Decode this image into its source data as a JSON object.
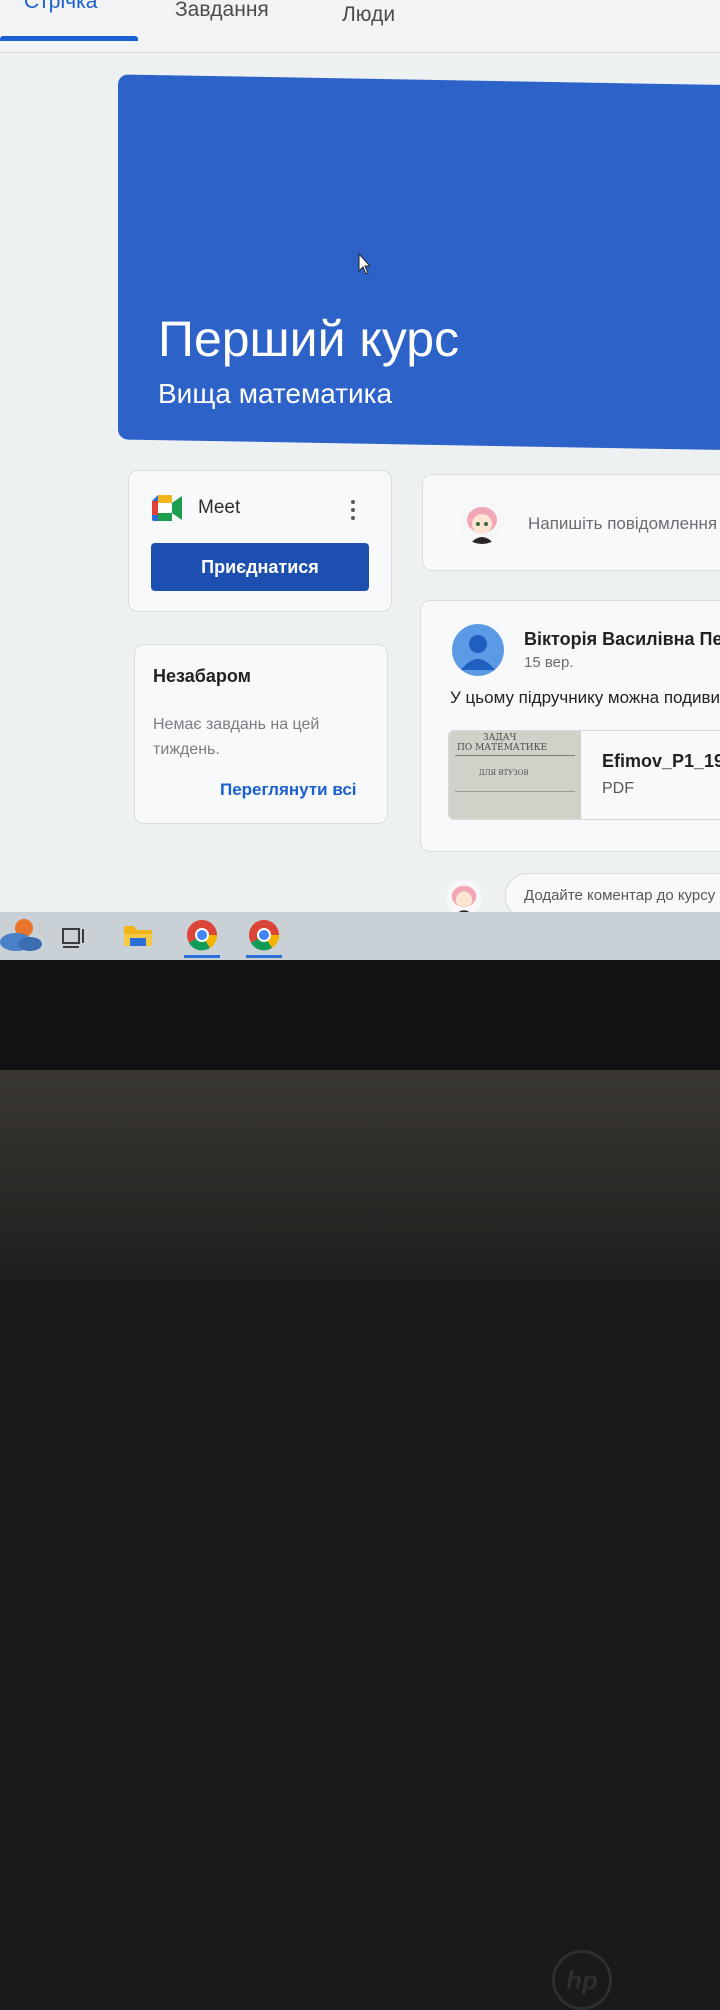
{
  "tabs": [
    {
      "label": "Стрічка",
      "active": true
    },
    {
      "label": "Завдання",
      "active": false
    },
    {
      "label": "Люди",
      "active": false
    }
  ],
  "banner": {
    "title": "Перший курс",
    "subtitle": "Вища математика",
    "color": "#2d62c8"
  },
  "meet": {
    "label": "Meet",
    "join_label": "Приєднатися"
  },
  "upcoming": {
    "title": "Незабаром",
    "empty_text": "Немає завдань на цей тиждень.",
    "view_all_label": "Переглянути всі"
  },
  "composer": {
    "placeholder": "Напишіть повідомлення"
  },
  "post": {
    "author": "Вікторія Василівна Пе",
    "date": "15 вер.",
    "text": "У цьому підручнику можна подиви",
    "attachment": {
      "name": "Efimov_P1_19",
      "type": "PDF",
      "thumb_lines": [
        "ЗАДАЧ",
        "ПО МАТЕМАТИКЕ",
        "ДЛЯ ВТУЗОВ"
      ]
    },
    "comment_placeholder": "Додайте коментар до курсу"
  },
  "taskbar": {
    "items": [
      "weather-icon",
      "task-view-icon",
      "file-explorer-icon",
      "chrome-icon",
      "chrome-icon"
    ]
  },
  "laptop": {
    "brand": "hp"
  }
}
